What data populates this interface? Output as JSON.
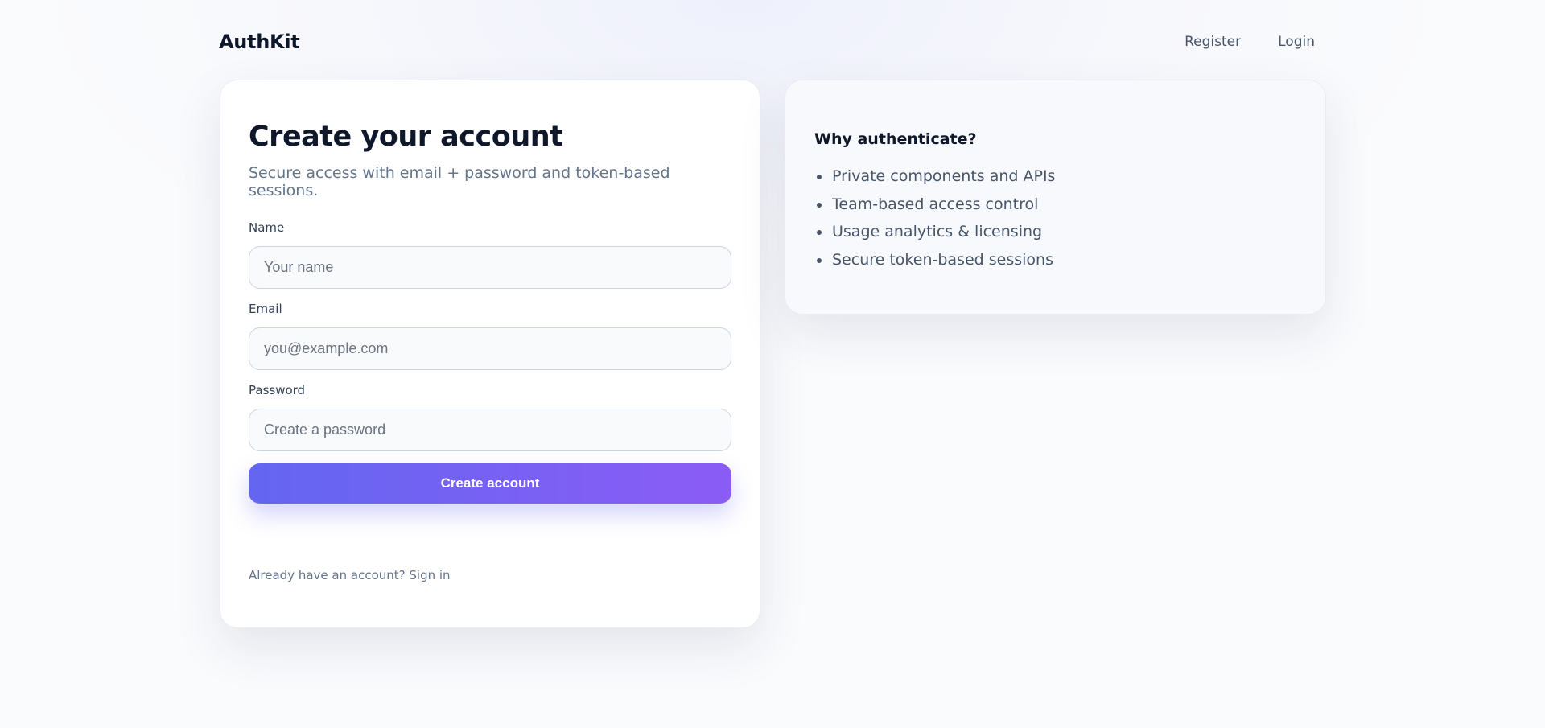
{
  "header": {
    "brand": "AuthKit",
    "nav": {
      "register": "Register",
      "login": "Login"
    }
  },
  "signup": {
    "title": "Create your account",
    "subtitle": "Secure access with email + password and token-based sessions.",
    "fields": {
      "name": {
        "label": "Name",
        "placeholder": "Your name",
        "value": ""
      },
      "email": {
        "label": "Email",
        "placeholder": "you@example.com",
        "value": ""
      },
      "password": {
        "label": "Password",
        "placeholder": "Create a password",
        "value": ""
      }
    },
    "submit_label": "Create account",
    "footer_text": "Already have an account?",
    "footer_link": "Sign in"
  },
  "why": {
    "title": "Why authenticate?",
    "items": [
      "Private components and APIs",
      "Team-based access control",
      "Usage analytics & licensing",
      "Secure token-based sessions"
    ]
  },
  "colors": {
    "accent_start": "#6366f1",
    "accent_end": "#8b5cf6",
    "text_primary": "#0f172a",
    "text_muted": "#64748b"
  }
}
